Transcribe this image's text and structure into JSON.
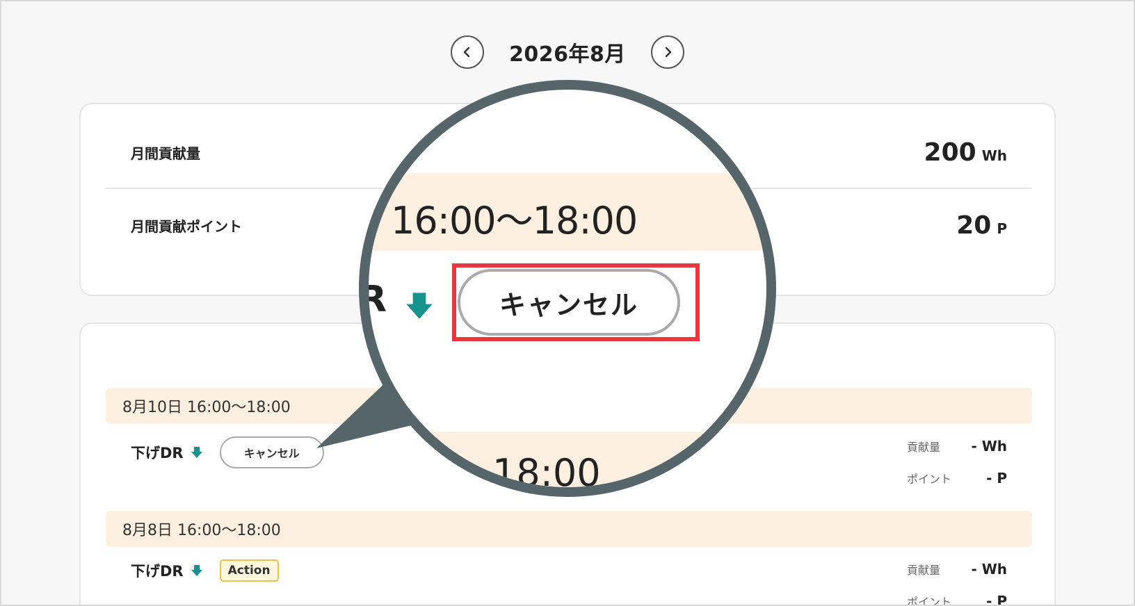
{
  "month_nav": {
    "prev_icon": "chevron-left-icon",
    "label": "2026年8月",
    "next_icon": "chevron-right-icon"
  },
  "summary": {
    "energy": {
      "label": "月間貢献量",
      "value": "200",
      "unit": "Wh"
    },
    "points": {
      "label": "月間貢献ポイント",
      "value": "20",
      "unit": "P"
    }
  },
  "events": [
    {
      "date": "8月10日 16:00〜18:00",
      "dr_label": "下げDR",
      "icon": "down-arrow-icon",
      "button_label": "キャンセル",
      "energy_label": "貢献量",
      "energy_value": "- Wh",
      "points_label": "ポイント",
      "points_value": "- P"
    },
    {
      "date": "8月8日 16:00〜18:00",
      "dr_label": "下げDR",
      "icon": "down-arrow-icon",
      "badge_label": "Action",
      "energy_label": "貢献量",
      "energy_value": "- Wh",
      "points_label": "ポイント",
      "points_value": "- P"
    }
  ],
  "magnifier": {
    "time": "16:00〜18:00",
    "dr_fragment": "R",
    "button_label": "キャンセル",
    "time2": "18:00"
  },
  "colors": {
    "accent_teal": "#14948c",
    "highlight_red": "#e8383d",
    "date_band": "#fdf0e1",
    "badge_border": "#f3c048",
    "magnifier_ring": "#56656a"
  }
}
